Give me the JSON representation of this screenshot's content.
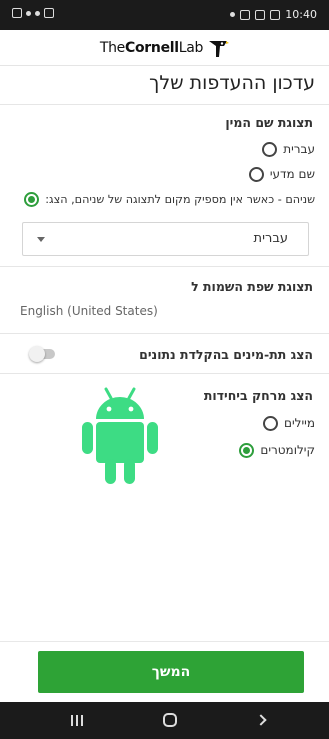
{
  "status_bar": {
    "time": "10:40"
  },
  "header": {
    "logo_the": "The",
    "logo_cornell": "Cornell",
    "logo_lab": "Lab"
  },
  "page": {
    "title": "עדכון ההעדפות שלך"
  },
  "species_name_display": {
    "title": "תצוגת שם המין",
    "options": [
      {
        "label": "עברית",
        "checked": false
      },
      {
        "label": "שם מדעי",
        "checked": false
      },
      {
        "label": "שניהם - כאשר אין מספיק מקום לתצוגה של שניהם, הצג:",
        "checked": true
      }
    ],
    "select_value": "עברית"
  },
  "naming_language": {
    "title": "תצוגת שפת השמות ל",
    "value": "English (United States)"
  },
  "subspecies_toggle": {
    "label": "הצג תת-מינים בהקלדת נתונים",
    "on": false
  },
  "distance_units": {
    "title": "הצג מרחק ביחידות",
    "options": [
      {
        "label": "מיילים",
        "checked": false
      },
      {
        "label": "קילומטרים",
        "checked": true
      }
    ]
  },
  "footer": {
    "continue_label": "המשך"
  },
  "colors": {
    "accent_green": "#2ea336",
    "android_green": "#3ddc84"
  },
  "icons": {
    "android": "android-robot-icon",
    "home": "home-icon",
    "back": "back-icon",
    "recent": "recent-apps-icon"
  }
}
